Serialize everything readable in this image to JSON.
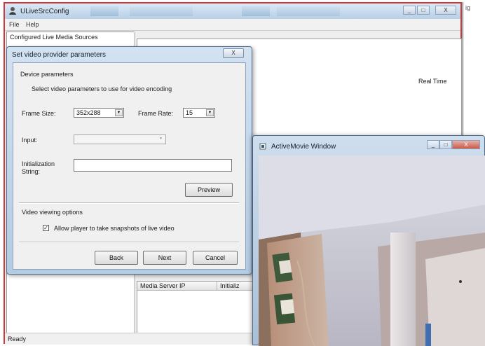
{
  "main_window": {
    "title": "ULiveSrcConfig",
    "menu": [
      "File",
      "Help"
    ],
    "left_panel_header": "Configured Live Media Sources",
    "right_panel_column": "Real Time",
    "bottom_table_headers": [
      "Media Server IP",
      "Initializ"
    ],
    "status": "Ready",
    "caption_buttons": [
      "minimize",
      "maximize",
      "close"
    ]
  },
  "dialog": {
    "title": "Set video provider parameters",
    "close_label": "X",
    "device_group": "Device parameters",
    "device_help": "Select video parameters to use for video encoding",
    "frame_size_label": "Frame Size:",
    "frame_size_value": "352x288",
    "frame_rate_label": "Frame Rate:",
    "frame_rate_value": "15",
    "input_label": "Input:",
    "input_value": "",
    "init_label_1": "Initialization",
    "init_label_2": "String:",
    "init_value": "",
    "preview_button": "Preview",
    "viewing_group": "Video viewing options",
    "snapshot_checkbox": "Allow player to take snapshots of live video",
    "snapshot_checked": true,
    "back_button": "Back",
    "next_button": "Next",
    "cancel_button": "Cancel"
  },
  "movie_window": {
    "title": "ActiveMovie Window"
  },
  "colors": {
    "main_border": "#d23a3a",
    "titlebar_top": "#dbe9f6",
    "titlebar_bottom": "#b8cfe6",
    "dialog_face": "#f0f0f0",
    "close_button": "#c85a4a"
  },
  "icons": [
    "app-icon",
    "dropdown-arrow-icon",
    "checkbox-check-icon",
    "window-close-icon",
    "window-menu-icon"
  ]
}
